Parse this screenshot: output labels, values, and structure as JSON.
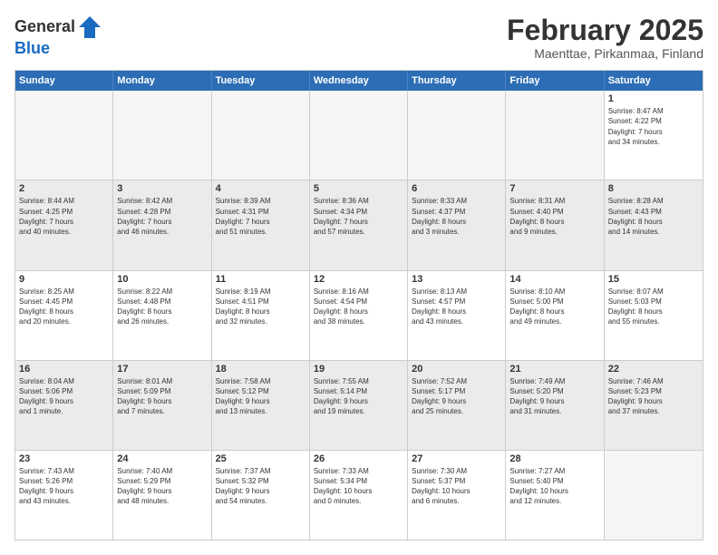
{
  "header": {
    "logo_line1": "General",
    "logo_line2": "Blue",
    "month_title": "February 2025",
    "location": "Maenttae, Pirkanmaa, Finland"
  },
  "weekdays": [
    "Sunday",
    "Monday",
    "Tuesday",
    "Wednesday",
    "Thursday",
    "Friday",
    "Saturday"
  ],
  "rows": [
    {
      "alt": false,
      "cells": [
        {
          "day": "",
          "info": ""
        },
        {
          "day": "",
          "info": ""
        },
        {
          "day": "",
          "info": ""
        },
        {
          "day": "",
          "info": ""
        },
        {
          "day": "",
          "info": ""
        },
        {
          "day": "",
          "info": ""
        },
        {
          "day": "1",
          "info": "Sunrise: 8:47 AM\nSunset: 4:22 PM\nDaylight: 7 hours\nand 34 minutes."
        }
      ]
    },
    {
      "alt": true,
      "cells": [
        {
          "day": "2",
          "info": "Sunrise: 8:44 AM\nSunset: 4:25 PM\nDaylight: 7 hours\nand 40 minutes."
        },
        {
          "day": "3",
          "info": "Sunrise: 8:42 AM\nSunset: 4:28 PM\nDaylight: 7 hours\nand 46 minutes."
        },
        {
          "day": "4",
          "info": "Sunrise: 8:39 AM\nSunset: 4:31 PM\nDaylight: 7 hours\nand 51 minutes."
        },
        {
          "day": "5",
          "info": "Sunrise: 8:36 AM\nSunset: 4:34 PM\nDaylight: 7 hours\nand 57 minutes."
        },
        {
          "day": "6",
          "info": "Sunrise: 8:33 AM\nSunset: 4:37 PM\nDaylight: 8 hours\nand 3 minutes."
        },
        {
          "day": "7",
          "info": "Sunrise: 8:31 AM\nSunset: 4:40 PM\nDaylight: 8 hours\nand 9 minutes."
        },
        {
          "day": "8",
          "info": "Sunrise: 8:28 AM\nSunset: 4:43 PM\nDaylight: 8 hours\nand 14 minutes."
        }
      ]
    },
    {
      "alt": false,
      "cells": [
        {
          "day": "9",
          "info": "Sunrise: 8:25 AM\nSunset: 4:45 PM\nDaylight: 8 hours\nand 20 minutes."
        },
        {
          "day": "10",
          "info": "Sunrise: 8:22 AM\nSunset: 4:48 PM\nDaylight: 8 hours\nand 26 minutes."
        },
        {
          "day": "11",
          "info": "Sunrise: 8:19 AM\nSunset: 4:51 PM\nDaylight: 8 hours\nand 32 minutes."
        },
        {
          "day": "12",
          "info": "Sunrise: 8:16 AM\nSunset: 4:54 PM\nDaylight: 8 hours\nand 38 minutes."
        },
        {
          "day": "13",
          "info": "Sunrise: 8:13 AM\nSunset: 4:57 PM\nDaylight: 8 hours\nand 43 minutes."
        },
        {
          "day": "14",
          "info": "Sunrise: 8:10 AM\nSunset: 5:00 PM\nDaylight: 8 hours\nand 49 minutes."
        },
        {
          "day": "15",
          "info": "Sunrise: 8:07 AM\nSunset: 5:03 PM\nDaylight: 8 hours\nand 55 minutes."
        }
      ]
    },
    {
      "alt": true,
      "cells": [
        {
          "day": "16",
          "info": "Sunrise: 8:04 AM\nSunset: 5:06 PM\nDaylight: 9 hours\nand 1 minute."
        },
        {
          "day": "17",
          "info": "Sunrise: 8:01 AM\nSunset: 5:09 PM\nDaylight: 9 hours\nand 7 minutes."
        },
        {
          "day": "18",
          "info": "Sunrise: 7:58 AM\nSunset: 5:12 PM\nDaylight: 9 hours\nand 13 minutes."
        },
        {
          "day": "19",
          "info": "Sunrise: 7:55 AM\nSunset: 5:14 PM\nDaylight: 9 hours\nand 19 minutes."
        },
        {
          "day": "20",
          "info": "Sunrise: 7:52 AM\nSunset: 5:17 PM\nDaylight: 9 hours\nand 25 minutes."
        },
        {
          "day": "21",
          "info": "Sunrise: 7:49 AM\nSunset: 5:20 PM\nDaylight: 9 hours\nand 31 minutes."
        },
        {
          "day": "22",
          "info": "Sunrise: 7:46 AM\nSunset: 5:23 PM\nDaylight: 9 hours\nand 37 minutes."
        }
      ]
    },
    {
      "alt": false,
      "cells": [
        {
          "day": "23",
          "info": "Sunrise: 7:43 AM\nSunset: 5:26 PM\nDaylight: 9 hours\nand 43 minutes."
        },
        {
          "day": "24",
          "info": "Sunrise: 7:40 AM\nSunset: 5:29 PM\nDaylight: 9 hours\nand 48 minutes."
        },
        {
          "day": "25",
          "info": "Sunrise: 7:37 AM\nSunset: 5:32 PM\nDaylight: 9 hours\nand 54 minutes."
        },
        {
          "day": "26",
          "info": "Sunrise: 7:33 AM\nSunset: 5:34 PM\nDaylight: 10 hours\nand 0 minutes."
        },
        {
          "day": "27",
          "info": "Sunrise: 7:30 AM\nSunset: 5:37 PM\nDaylight: 10 hours\nand 6 minutes."
        },
        {
          "day": "28",
          "info": "Sunrise: 7:27 AM\nSunset: 5:40 PM\nDaylight: 10 hours\nand 12 minutes."
        },
        {
          "day": "",
          "info": ""
        }
      ]
    }
  ]
}
